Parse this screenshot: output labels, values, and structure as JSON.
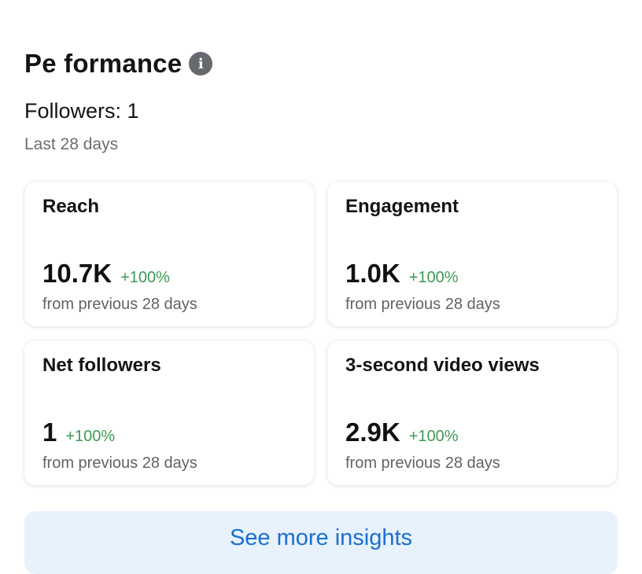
{
  "header": {
    "title": "Pe formance",
    "info_icon": "info-icon"
  },
  "summary": {
    "followers_text": "Followers: 1",
    "period": "Last 28 days"
  },
  "cards": [
    {
      "title": "Reach",
      "value": "10.7K",
      "change": "+100%",
      "comparison": "from previous 28 days"
    },
    {
      "title": "Engagement",
      "value": "1.0K",
      "change": "+100%",
      "comparison": "from previous 28 days"
    },
    {
      "title": "Net followers",
      "value": "1",
      "change": "+100%",
      "comparison": "from previous 28 days"
    },
    {
      "title": "3-second video views",
      "value": "2.9K",
      "change": "+100%",
      "comparison": "from previous 28 days"
    }
  ],
  "actions": {
    "see_more_label": "See more insights"
  },
  "colors": {
    "positive_change": "#3d9a52",
    "button_text": "#1a6fd0",
    "button_bg": "#e8f2fd"
  }
}
